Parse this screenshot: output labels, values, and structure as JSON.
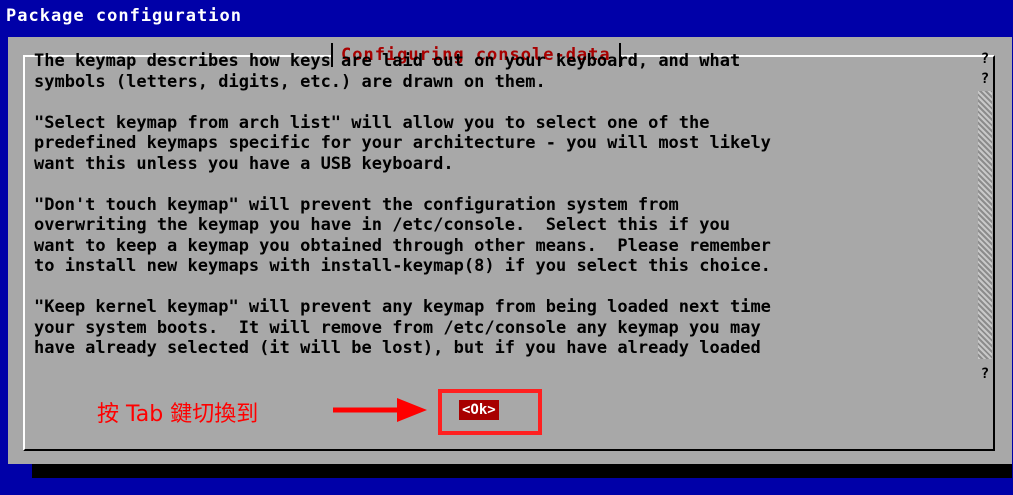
{
  "window": {
    "title": "Package configuration"
  },
  "dialog": {
    "title": "Configuring console-data",
    "text": "The keymap describes how keys are laid out on your keyboard, and what\nsymbols (letters, digits, etc.) are drawn on them.\n\n\"Select keymap from arch list\" will allow you to select one of the\npredefined keymaps specific for your architecture - you will most likely\nwant this unless you have a USB keyboard.\n\n\"Don't touch keymap\" will prevent the configuration system from\noverwriting the keymap you have in /etc/console.  Select this if you\nwant to keep a keymap you obtained through other means.  Please remember\nto install new keymaps with install-keymap(8) if you select this choice.\n\n\"Keep kernel keymap\" will prevent any keymap from being loaded next time\nyour system boots.  It will remove from /etc/console any keymap you may\nhave already selected (it will be lost), but if you have already loaded",
    "ok_label": "<Ok>",
    "scroll_marker": "?"
  },
  "annotation": {
    "text": "按 Tab 鍵切換到",
    "color": "#ff0000"
  },
  "colors": {
    "background": "#0000a8",
    "dialog": "#a8a8a8",
    "title_accent": "#a80000",
    "ok_button": "#a80000"
  }
}
